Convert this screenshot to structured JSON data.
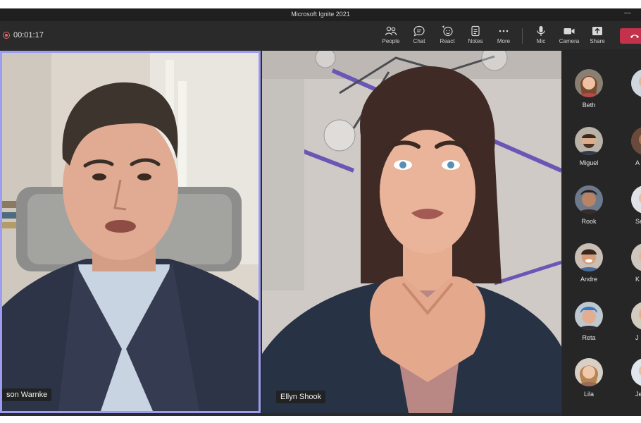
{
  "window": {
    "title": "Microsoft Ignite 2021"
  },
  "call": {
    "timer": "00:01:17"
  },
  "toolbar": {
    "people_label": "People",
    "chat_label": "Chat",
    "react_label": "React",
    "notes_label": "Notes",
    "more_label": "More",
    "mic_label": "Mic",
    "camera_label": "Camera",
    "share_label": "Share"
  },
  "tiles": [
    {
      "name": "son Warnke"
    },
    {
      "name": "Ellyn Shook"
    }
  ],
  "roster": [
    {
      "name": "Beth",
      "partial": ""
    },
    {
      "name": "Miguel",
      "partial": "A"
    },
    {
      "name": "Rook",
      "partial": "Se"
    },
    {
      "name": "Andre",
      "partial": "K"
    },
    {
      "name": "Reta",
      "partial": "J"
    },
    {
      "name": "Lila",
      "partial": "Je"
    }
  ],
  "colors": {
    "leave": "#c4314b",
    "active_speaker_border": "#9c9cf2",
    "toolbar": "#2a2a2b"
  }
}
